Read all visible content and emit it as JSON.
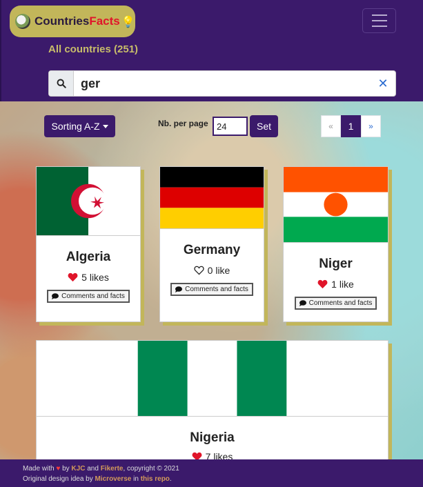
{
  "brand": {
    "name_part1": "Countries",
    "name_part2": "Facts",
    "bulb_icon": "lightbulb-icon"
  },
  "header": {
    "count_label": "All countries (251)"
  },
  "search": {
    "value": "ger",
    "placeholder": ""
  },
  "controls": {
    "sort_label": "Sorting A-Z",
    "per_page_label": "Nb. per page",
    "per_page_value": "24",
    "set_label": "Set",
    "pager": {
      "prev": "«",
      "current": "1",
      "next": "»"
    }
  },
  "cards": [
    {
      "name": "Algeria",
      "likes": "5 likes",
      "liked": true,
      "comments": "Comments and facts"
    },
    {
      "name": "Germany",
      "likes": "0 like",
      "liked": false,
      "comments": "Comments and facts"
    },
    {
      "name": "Niger",
      "likes": "1 like",
      "liked": true,
      "comments": "Comments and facts"
    },
    {
      "name": "Nigeria",
      "likes": "7 likes",
      "liked": true
    }
  ],
  "footer": {
    "made_with": "Made with",
    "by": "by",
    "author1": "KJC",
    "and": "and",
    "author2": "Fikerte",
    "copyright": ", copyright © 2021",
    "original": "Original design idea by",
    "design_by": "Microverse",
    "in": "in",
    "repo": "this repo",
    "period": "."
  },
  "colors": {
    "primary": "#3b1a6b",
    "accent": "#c2b65a",
    "heart": "#e0152a",
    "link": "#2a6bd1"
  }
}
